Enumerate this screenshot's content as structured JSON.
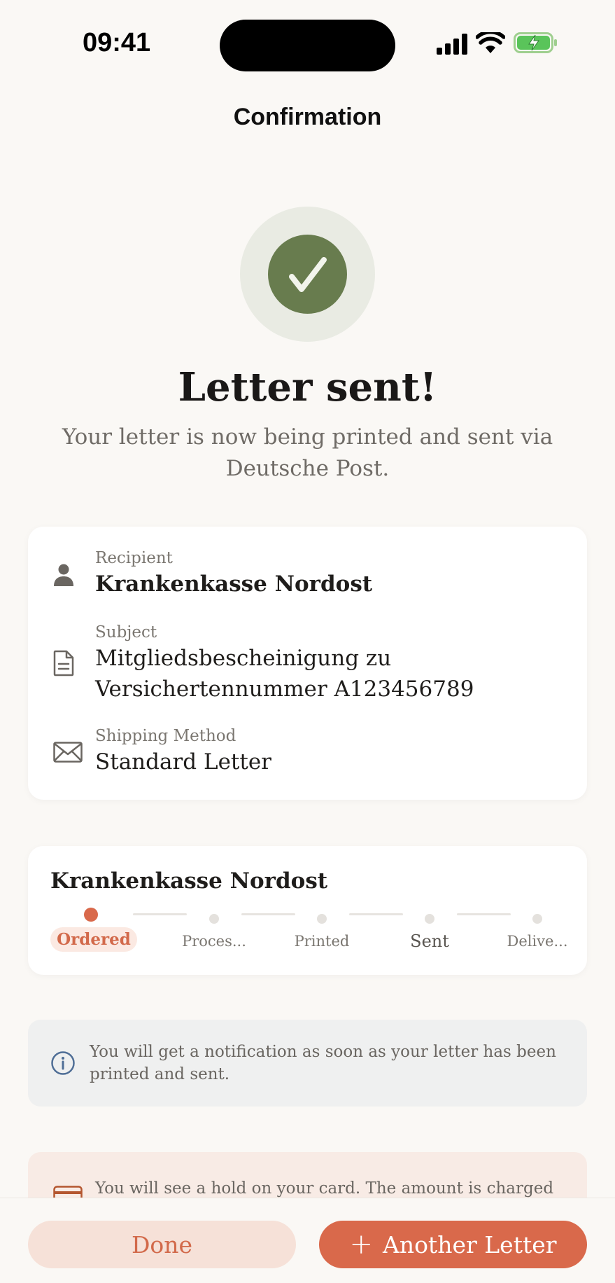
{
  "status_bar": {
    "time": "09:41"
  },
  "nav": {
    "title": "Confirmation"
  },
  "success": {
    "icon": "checkmark-icon",
    "headline": "Letter sent!",
    "subline": "Your letter is now being printed and sent via Deutsche Post."
  },
  "details": {
    "recipient_label": "Recipient",
    "recipient_value": "Krankenkasse Nordost",
    "subject_label": "Subject",
    "subject_value": "Mitgliedsbescheinigung zu Versichertennummer A123456789",
    "shipping_label": "Shipping Method",
    "shipping_value": "Standard Letter"
  },
  "tracking": {
    "title": "Krankenkasse Nordost",
    "steps": [
      {
        "label": "Ordered",
        "active": true
      },
      {
        "label": "Proces...",
        "active": false
      },
      {
        "label": "Printed",
        "active": false
      },
      {
        "label": "Sent",
        "active": false
      },
      {
        "label": "Delive...",
        "active": false
      }
    ]
  },
  "info": {
    "notification_text": "You will get a notification as soon as your letter has been printed and sent.",
    "hold_text": "You will see a hold on your card. The amount is charged"
  },
  "actions": {
    "done_label": "Done",
    "another_plus": "+",
    "another_label": "Another Letter"
  },
  "colors": {
    "accent": "#d9694b",
    "success": "#687c4e",
    "background": "#faf8f5"
  }
}
